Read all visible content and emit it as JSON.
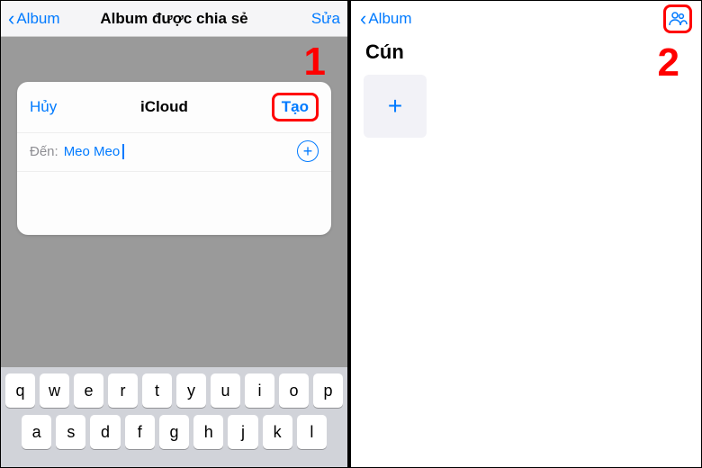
{
  "left": {
    "nav": {
      "back": "Album",
      "title": "Album được chia sẻ",
      "edit": "Sửa"
    },
    "step": "1",
    "sheet": {
      "cancel": "Hủy",
      "title": "iCloud",
      "create": "Tạo",
      "to_label": "Đến:",
      "to_value": "Meo Meo"
    },
    "kb": {
      "r1": [
        "q",
        "w",
        "e",
        "r",
        "t",
        "y",
        "u",
        "i",
        "o",
        "p"
      ],
      "r2": [
        "a",
        "s",
        "d",
        "f",
        "g",
        "h",
        "j",
        "k",
        "l"
      ]
    }
  },
  "right": {
    "nav": {
      "back": "Album"
    },
    "step": "2",
    "title": "Cún"
  }
}
